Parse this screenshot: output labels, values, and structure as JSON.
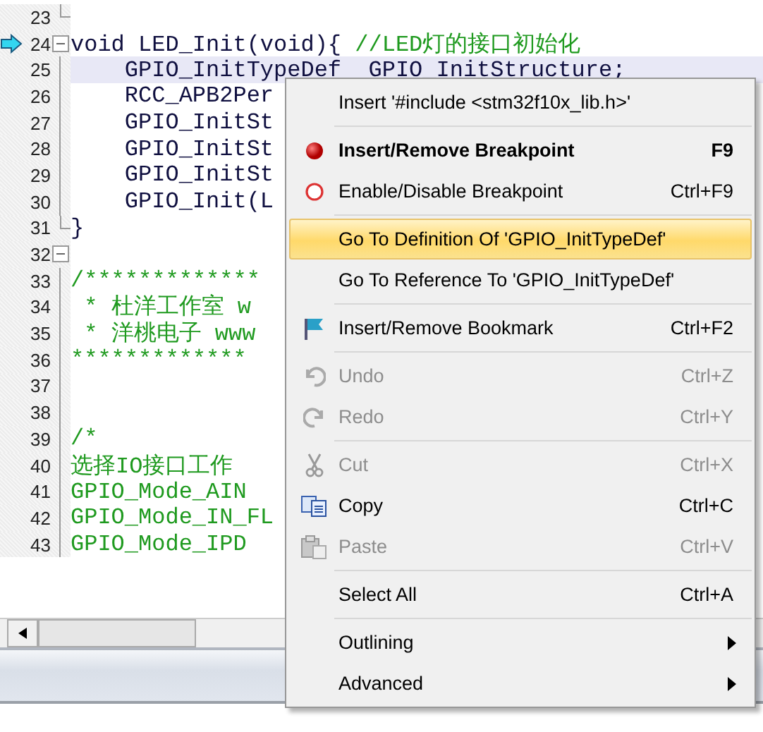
{
  "editor": {
    "lines": [
      {
        "number": "23",
        "kind": "fold-end",
        "arrow": false,
        "current": false
      },
      {
        "number": "24",
        "kind": "fold-start",
        "arrow": true,
        "current": false,
        "segments": [
          {
            "kind": "code",
            "text": "void LED_Init(void){ "
          },
          {
            "kind": "comment",
            "text": "//LED灯的接口初始化"
          }
        ]
      },
      {
        "number": "25",
        "kind": "body",
        "arrow": false,
        "current": true,
        "segments": [
          {
            "kind": "code",
            "text": "    GPIO_InitTypeDef  GPIO_InitStructure;"
          }
        ]
      },
      {
        "number": "26",
        "kind": "body",
        "arrow": false,
        "current": false,
        "segments": [
          {
            "kind": "code",
            "text": "    RCC_APB2Per"
          }
        ]
      },
      {
        "number": "27",
        "kind": "body",
        "arrow": false,
        "current": false,
        "segments": [
          {
            "kind": "code",
            "text": "    GPIO_InitSt"
          }
        ]
      },
      {
        "number": "28",
        "kind": "body",
        "arrow": false,
        "current": false,
        "segments": [
          {
            "kind": "code",
            "text": "    GPIO_InitSt"
          }
        ]
      },
      {
        "number": "29",
        "kind": "body",
        "arrow": false,
        "current": false,
        "segments": [
          {
            "kind": "code",
            "text": "    GPIO_InitSt"
          }
        ]
      },
      {
        "number": "30",
        "kind": "body",
        "arrow": false,
        "current": false,
        "segments": [
          {
            "kind": "code",
            "text": "    GPIO_Init(L"
          }
        ]
      },
      {
        "number": "31",
        "kind": "fold-end",
        "arrow": false,
        "current": false,
        "segments": [
          {
            "kind": "code",
            "text": "}"
          }
        ]
      },
      {
        "number": "32",
        "kind": "fold-start",
        "arrow": false,
        "current": false
      },
      {
        "number": "33",
        "kind": "body",
        "arrow": false,
        "current": false,
        "segments": [
          {
            "kind": "comment",
            "text": "/*************"
          }
        ]
      },
      {
        "number": "34",
        "kind": "body",
        "arrow": false,
        "current": false,
        "segments": [
          {
            "kind": "comment",
            "text": " * 杜洋工作室 w"
          }
        ]
      },
      {
        "number": "35",
        "kind": "body",
        "arrow": false,
        "current": false,
        "segments": [
          {
            "kind": "comment",
            "text": " * 洋桃电子 www"
          }
        ]
      },
      {
        "number": "36",
        "kind": "body",
        "arrow": false,
        "current": false,
        "segments": [
          {
            "kind": "comment",
            "text": "*************"
          }
        ]
      },
      {
        "number": "37",
        "kind": "body",
        "arrow": false,
        "current": false
      },
      {
        "number": "38",
        "kind": "body",
        "arrow": false,
        "current": false
      },
      {
        "number": "39",
        "kind": "body",
        "arrow": false,
        "current": false,
        "segments": [
          {
            "kind": "comment",
            "text": "/*"
          }
        ]
      },
      {
        "number": "40",
        "kind": "body",
        "arrow": false,
        "current": false,
        "segments": [
          {
            "kind": "comment",
            "text": "选择IO接口工作"
          }
        ]
      },
      {
        "number": "41",
        "kind": "body",
        "arrow": false,
        "current": false,
        "segments": [
          {
            "kind": "comment",
            "text": "GPIO_Mode_AIN"
          }
        ]
      },
      {
        "number": "42",
        "kind": "body",
        "arrow": false,
        "current": false,
        "segments": [
          {
            "kind": "comment",
            "text": "GPIO_Mode_IN_FL"
          }
        ]
      },
      {
        "number": "43",
        "kind": "body",
        "arrow": false,
        "current": false,
        "segments": [
          {
            "kind": "comment",
            "text": "GPIO_Mode_IPD"
          }
        ]
      }
    ]
  },
  "context_menu": {
    "items": [
      {
        "kind": "item",
        "label": "Insert '#include <stm32f10x_lib.h>'",
        "bold": false,
        "disabled": false,
        "selected": false
      },
      {
        "kind": "separator"
      },
      {
        "kind": "item",
        "label": "Insert/Remove Breakpoint",
        "shortcut": "F9",
        "bold": true,
        "disabled": false,
        "selected": false
      },
      {
        "kind": "item",
        "label": "Enable/Disable Breakpoint",
        "shortcut": "Ctrl+F9",
        "bold": false,
        "disabled": false,
        "selected": false
      },
      {
        "kind": "separator"
      },
      {
        "kind": "item",
        "label": "Go To Definition Of 'GPIO_InitTypeDef'",
        "bold": false,
        "disabled": false,
        "selected": true
      },
      {
        "kind": "item",
        "label": "Go To Reference To 'GPIO_InitTypeDef'",
        "bold": false,
        "disabled": false,
        "selected": false
      },
      {
        "kind": "separator"
      },
      {
        "kind": "item",
        "label": "Insert/Remove Bookmark",
        "shortcut": "Ctrl+F2",
        "bold": false,
        "disabled": false,
        "selected": false
      },
      {
        "kind": "separator"
      },
      {
        "kind": "item",
        "label": "Undo",
        "shortcut": "Ctrl+Z",
        "bold": false,
        "disabled": true,
        "selected": false
      },
      {
        "kind": "item",
        "label": "Redo",
        "shortcut": "Ctrl+Y",
        "bold": false,
        "disabled": true,
        "selected": false
      },
      {
        "kind": "separator"
      },
      {
        "kind": "item",
        "label": "Cut",
        "shortcut": "Ctrl+X",
        "bold": false,
        "disabled": true,
        "selected": false
      },
      {
        "kind": "item",
        "label": "Copy",
        "shortcut": "Ctrl+C",
        "bold": false,
        "disabled": false,
        "selected": false
      },
      {
        "kind": "item",
        "label": "Paste",
        "shortcut": "Ctrl+V",
        "bold": false,
        "disabled": true,
        "selected": false
      },
      {
        "kind": "separator"
      },
      {
        "kind": "item",
        "label": "Select All",
        "shortcut": "Ctrl+A",
        "bold": false,
        "disabled": false,
        "selected": false
      },
      {
        "kind": "separator"
      },
      {
        "kind": "submenu",
        "label": "Outlining",
        "bold": false,
        "disabled": false,
        "selected": false
      },
      {
        "kind": "submenu",
        "label": "Advanced",
        "bold": false,
        "disabled": false,
        "selected": false
      }
    ]
  }
}
